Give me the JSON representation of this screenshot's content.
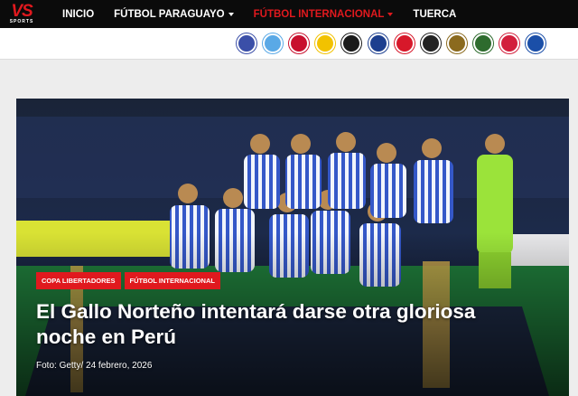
{
  "header": {
    "logo_main": "VS",
    "logo_sub": "SPORTS",
    "nav": [
      {
        "label": "INICIO",
        "has_dropdown": false,
        "active": false
      },
      {
        "label": "FÚTBOL PARAGUAYO",
        "has_dropdown": true,
        "active": false
      },
      {
        "label": "FÚTBOL INTERNACIONAL",
        "has_dropdown": true,
        "active": true
      },
      {
        "label": "TUERCA",
        "has_dropdown": false,
        "active": false
      }
    ],
    "accent_color": "#e0191e"
  },
  "club_bar": {
    "clubs": [
      {
        "icon": "club-crest-1-icon",
        "color": "#3b4fa8"
      },
      {
        "icon": "club-crest-2-icon",
        "color": "#5aa9e6"
      },
      {
        "icon": "club-crest-3-icon",
        "color": "#c8102e"
      },
      {
        "icon": "club-crest-4-icon",
        "color": "#f2c200"
      },
      {
        "icon": "club-crest-5-icon",
        "color": "#1a1a1a"
      },
      {
        "icon": "club-crest-6-icon",
        "color": "#1d3f8f"
      },
      {
        "icon": "club-crest-7-icon",
        "color": "#d7182a"
      },
      {
        "icon": "club-crest-8-icon",
        "color": "#222222"
      },
      {
        "icon": "club-crest-9-icon",
        "color": "#8b6a1e"
      },
      {
        "icon": "club-crest-10-icon",
        "color": "#2e6b2e"
      },
      {
        "icon": "club-crest-11-icon",
        "color": "#d21f3c"
      },
      {
        "icon": "club-crest-12-icon",
        "color": "#1b4fa8"
      }
    ]
  },
  "article": {
    "tags": [
      "COPA LIBERTADORES",
      "FÚTBOL INTERNACIONAL"
    ],
    "title": "El Gallo Norteño intentará darse otra gloriosa noche en Perú",
    "caption": "Foto: Getty/ 24 febrero, 2026",
    "image_icon": "team-photo"
  }
}
